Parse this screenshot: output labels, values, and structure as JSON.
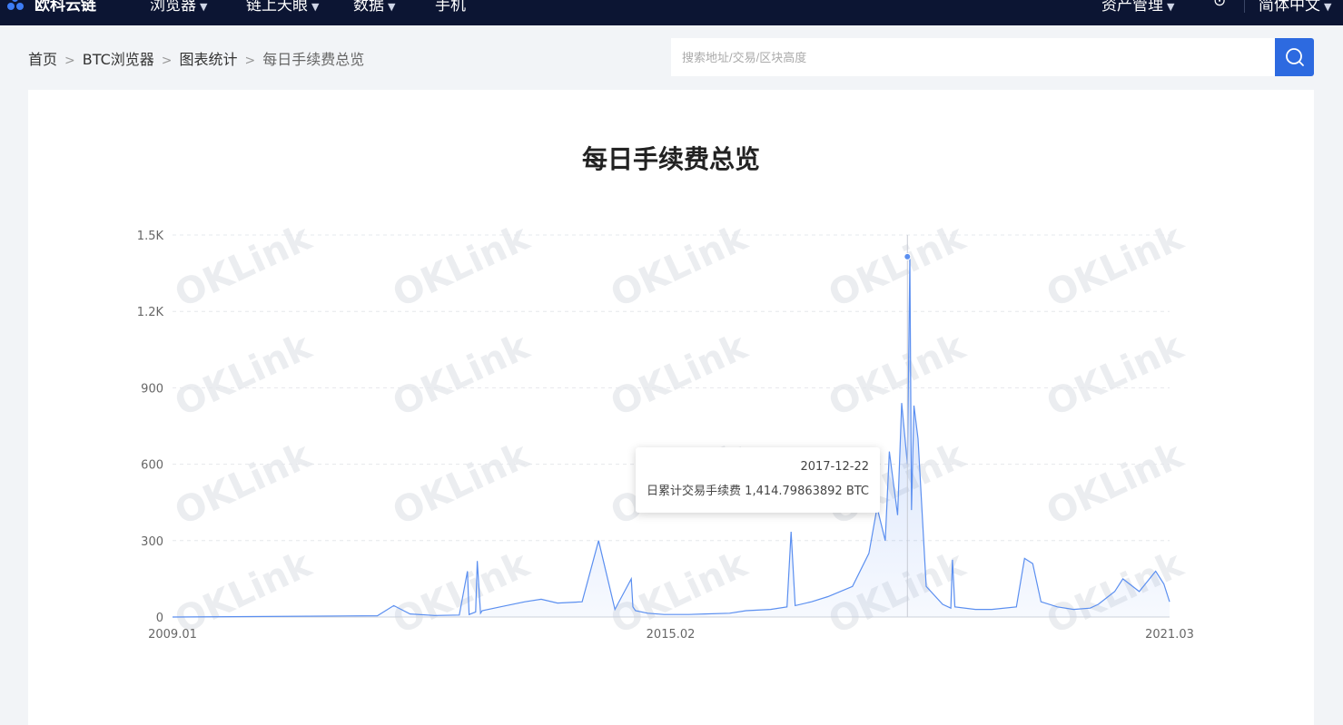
{
  "topnav": {
    "brand": "欧科云链",
    "items": [
      "浏览器",
      "链上天眼",
      "数据",
      "手机"
    ],
    "right_items": [
      "资产管理",
      "⊙",
      "简体中文"
    ]
  },
  "breadcrumb": [
    "首页",
    "BTC浏览器",
    "图表统计",
    "每日手续费总览"
  ],
  "search": {
    "placeholder": "搜索地址/交易/区块高度"
  },
  "watermark": "OKLink",
  "tooltip": {
    "date": "2017-12-22",
    "label": "日累计交易手续费",
    "value": "1,414.79863892 BTC"
  },
  "chart_data": {
    "type": "area",
    "title": "每日手续费总览",
    "xlabel": "",
    "ylabel": "",
    "x_ticks": [
      "2009.01",
      "2015.02",
      "2021.03"
    ],
    "y_ticks": [
      "0",
      "300",
      "600",
      "900",
      "1.2K",
      "1.5K"
    ],
    "ylim": [
      0,
      1500
    ],
    "xlim": [
      2009.0,
      2021.17
    ],
    "grid": "horizontal-dashed",
    "color": "#5b8ff0",
    "series": [
      {
        "name": "",
        "x": [
          2009.0,
          2011.5,
          2011.7,
          2011.9,
          2012.2,
          2012.5,
          2012.6,
          2012.62,
          2012.7,
          2012.72,
          2012.76,
          2012.78,
          2013.0,
          2013.3,
          2013.5,
          2013.7,
          2014.0,
          2014.2,
          2014.4,
          2014.6,
          2014.62,
          2014.65,
          2014.8,
          2015.0,
          2015.3,
          2015.5,
          2015.8,
          2016.0,
          2016.3,
          2016.5,
          2016.55,
          2016.6,
          2016.8,
          2017.0,
          2017.3,
          2017.5,
          2017.6,
          2017.7,
          2017.75,
          2017.85,
          2017.9,
          2017.97,
          2018.0,
          2018.02,
          2018.05,
          2018.1,
          2018.2,
          2018.4,
          2018.5,
          2018.52,
          2018.55,
          2018.8,
          2019.0,
          2019.3,
          2019.4,
          2019.5,
          2019.6,
          2019.8,
          2020.0,
          2020.2,
          2020.3,
          2020.5,
          2020.6,
          2020.8,
          2021.0,
          2021.1,
          2021.17
        ],
        "y": [
          0,
          5,
          45,
          12,
          6,
          8,
          180,
          10,
          20,
          220,
          15,
          25,
          40,
          60,
          70,
          55,
          60,
          300,
          30,
          150,
          40,
          25,
          15,
          10,
          10,
          12,
          15,
          25,
          30,
          40,
          335,
          45,
          60,
          80,
          120,
          250,
          430,
          300,
          650,
          400,
          840,
          600,
          1414,
          420,
          830,
          700,
          120,
          50,
          35,
          225,
          40,
          30,
          30,
          40,
          230,
          210,
          60,
          40,
          30,
          35,
          50,
          100,
          150,
          100,
          180,
          130,
          60
        ]
      }
    ],
    "highlight": {
      "x": 2017.97,
      "y": 1414.8
    }
  }
}
